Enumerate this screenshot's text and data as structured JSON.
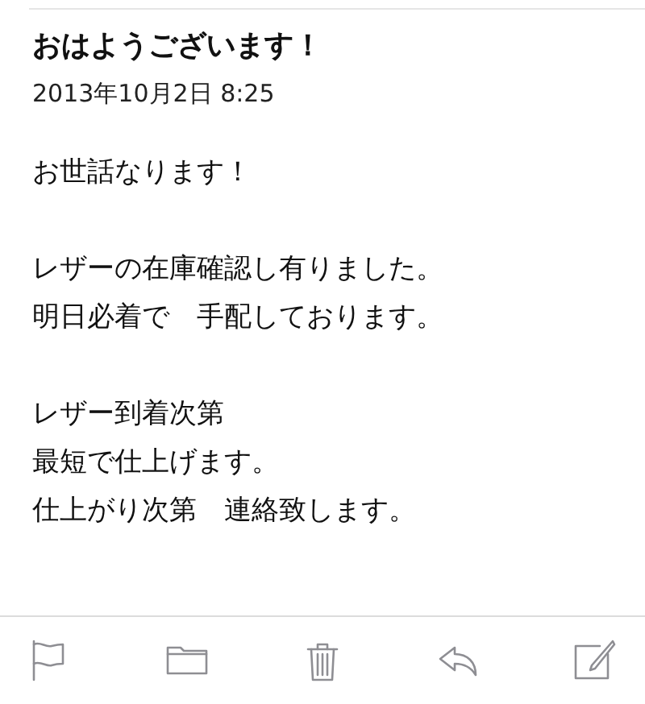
{
  "message": {
    "subject": "おはようございます！",
    "date": "2013年10月2日 8:25",
    "body": [
      [
        "お世話なります！"
      ],
      [
        "レザーの在庫確認し有りました。",
        "明日必着で　手配しております。"
      ],
      [
        "レザー到着次第",
        "最短で仕上げます。",
        "仕上がり次第　連絡致します。"
      ]
    ]
  },
  "toolbar": [
    {
      "kind": "flag"
    },
    {
      "kind": "folder"
    },
    {
      "kind": "trash"
    },
    {
      "kind": "reply"
    },
    {
      "kind": "compose"
    }
  ]
}
